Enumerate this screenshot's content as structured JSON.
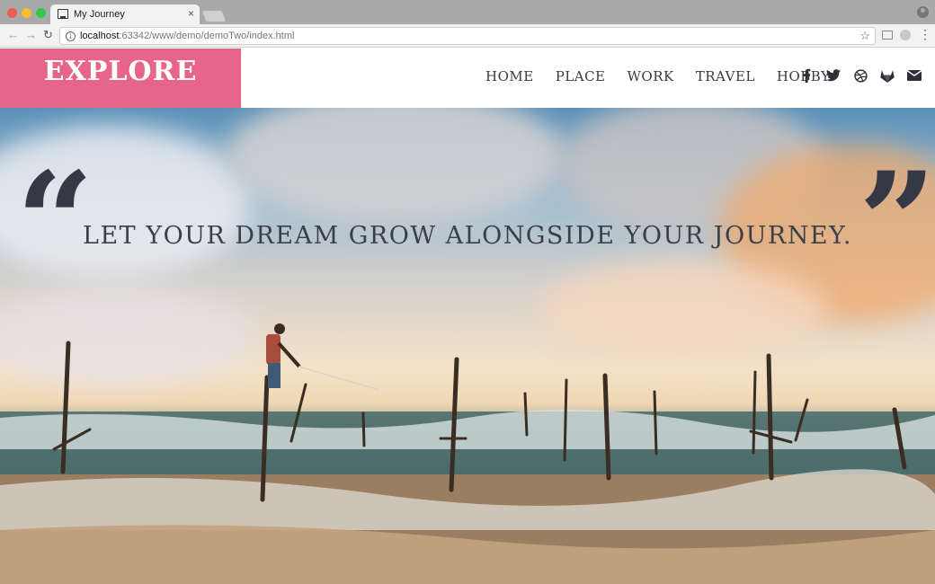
{
  "browser": {
    "tab_title": "My Journey",
    "tab_close": "×",
    "url_host": "localhost",
    "url_rest": ":63342/www/demo/demoTwo/index.html",
    "back": "←",
    "forward": "→",
    "reload": "↻",
    "star": "☆",
    "menu": "⋮",
    "info": "i"
  },
  "site": {
    "logo": "EXPLORE",
    "nav": [
      "HOME",
      "PLACE",
      "WORK",
      "TRAVEL",
      "HOBBY"
    ],
    "socials": [
      "facebook-icon",
      "twitter-icon",
      "dribbble-icon",
      "gitlab-icon",
      "envelope-icon"
    ]
  },
  "hero": {
    "quote_open": "“",
    "quote_close": "”",
    "tagline": "LET YOUR DREAM GROW ALONGSIDE YOUR JOURNEY."
  },
  "colors": {
    "logo_bg": "#e8658a",
    "text_dark": "#353845"
  }
}
